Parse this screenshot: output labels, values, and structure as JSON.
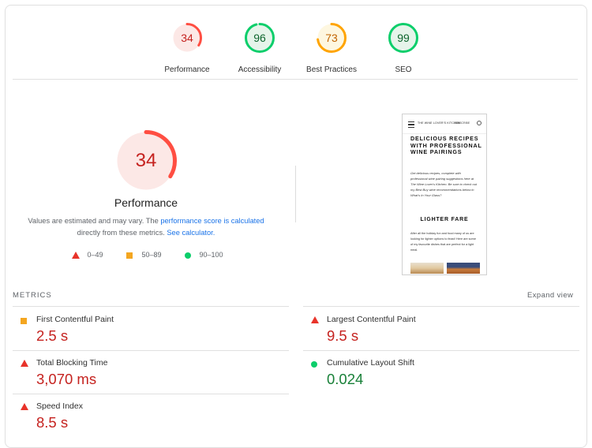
{
  "scores": [
    {
      "label": "Performance",
      "value": "34",
      "pct": 34,
      "color": "#ff4e42",
      "bg": "#fce8e6",
      "text": "#c5221f"
    },
    {
      "label": "Accessibility",
      "value": "96",
      "pct": 96,
      "color": "#0cce6b",
      "bg": "#e6f4ea",
      "text": "#0d652d"
    },
    {
      "label": "Best Practices",
      "value": "73",
      "pct": 73,
      "color": "#ffa400",
      "bg": "#fef7e0",
      "text": "#c26401"
    },
    {
      "label": "SEO",
      "value": "99",
      "pct": 99,
      "color": "#0cce6b",
      "bg": "#e6f4ea",
      "text": "#0d652d"
    }
  ],
  "main": {
    "score": "34",
    "title": "Performance",
    "desc_prefix": "Values are estimated and may vary. The ",
    "desc_link1": "performance score is calculated",
    "desc_middle": " directly from these metrics. ",
    "desc_link2": "See calculator.",
    "legend": [
      {
        "icon": "triangle-red",
        "range": "0–49"
      },
      {
        "icon": "square-orange",
        "range": "50–89"
      },
      {
        "icon": "circle-green",
        "range": "90–100"
      }
    ]
  },
  "screenshot": {
    "brand": "THE WINE LOVER'S KITCHEN",
    "subscribe": "SUBSCRIBE",
    "headline": "DELICIOUS RECIPES WITH PROFESSIONAL WINE PAIRINGS",
    "intro": "Get delicious recipes, complete with professional wine pairing suggestions here at The Wine Lover's Kitchen. Be sure to check out my Best Buy wine recommendations below in What's In Your Glass?",
    "section": "LIGHTER FARE",
    "body": "After all the holiday fun and food many of us are looking for lighter options to feast! Here are some of my favourite dishes that are perfect for a light meal."
  },
  "metrics": {
    "heading": "METRICS",
    "expand": "Expand view",
    "items": [
      {
        "name": "First Contentful Paint",
        "value": "2.5 s",
        "status": "orange"
      },
      {
        "name": "Largest Contentful Paint",
        "value": "9.5 s",
        "status": "red"
      },
      {
        "name": "Total Blocking Time",
        "value": "3,070 ms",
        "status": "red"
      },
      {
        "name": "Cumulative Layout Shift",
        "value": "0.024",
        "status": "green"
      },
      {
        "name": "Speed Index",
        "value": "8.5 s",
        "status": "red"
      }
    ]
  }
}
